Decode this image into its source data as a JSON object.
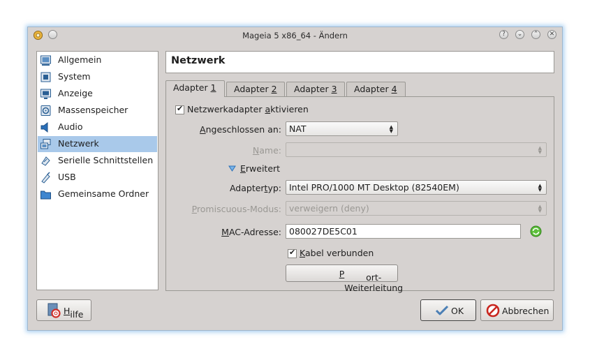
{
  "window": {
    "title": "Mageia 5 x86_64 - Ändern"
  },
  "sidebar": {
    "items": [
      {
        "label": "Allgemein",
        "icon": "general-icon"
      },
      {
        "label": "System",
        "icon": "system-icon"
      },
      {
        "label": "Anzeige",
        "icon": "display-icon"
      },
      {
        "label": "Massenspeicher",
        "icon": "storage-icon"
      },
      {
        "label": "Audio",
        "icon": "audio-icon"
      },
      {
        "label": "Netzwerk",
        "icon": "network-icon"
      },
      {
        "label": "Serielle Schnittstellen",
        "icon": "serial-port-icon"
      },
      {
        "label": "USB",
        "icon": "usb-icon"
      },
      {
        "label": "Gemeinsame Ordner",
        "icon": "shared-folder-icon"
      }
    ],
    "selected": "Netzwerk"
  },
  "page": {
    "title": "Netzwerk"
  },
  "tabs": [
    {
      "prefix": "Adapter ",
      "key": "1"
    },
    {
      "prefix": "Adapter ",
      "key": "2"
    },
    {
      "prefix": "Adapter ",
      "key": "3"
    },
    {
      "prefix": "Adapter ",
      "key": "4"
    }
  ],
  "form": {
    "enable": {
      "pre": "Netzwerkadapter ",
      "key": "a",
      "post": "ktivieren",
      "checked": true
    },
    "attached": {
      "key": "A",
      "post": "ngeschlossen an:",
      "value": "NAT"
    },
    "name": {
      "key": "N",
      "post": "ame:",
      "value": ""
    },
    "advanced": {
      "key": "E",
      "post": "rweitert"
    },
    "adapter_type": {
      "pre": "Adapter",
      "key": "t",
      "post": "yp:",
      "value": "Intel PRO/1000 MT Desktop (82540EM)"
    },
    "promiscuous": {
      "key": "P",
      "post": "romiscuous-Modus:",
      "value": "verweigern (deny)"
    },
    "mac": {
      "key": "M",
      "post": "AC-Adresse:",
      "value": "080027DE5C01"
    },
    "cable": {
      "key": "K",
      "post": "abel verbunden",
      "checked": true
    },
    "port_forward": {
      "key": "P",
      "post": "ort-Weiterleitung"
    }
  },
  "buttons": {
    "help": {
      "key": "H",
      "post": "ilfe"
    },
    "ok": {
      "label": "OK"
    },
    "cancel": {
      "label": "Abbrechen"
    }
  },
  "colors": {
    "selection": "#a9c9ea",
    "background": "#d6d2d0",
    "window_glow": "#64aae6"
  }
}
